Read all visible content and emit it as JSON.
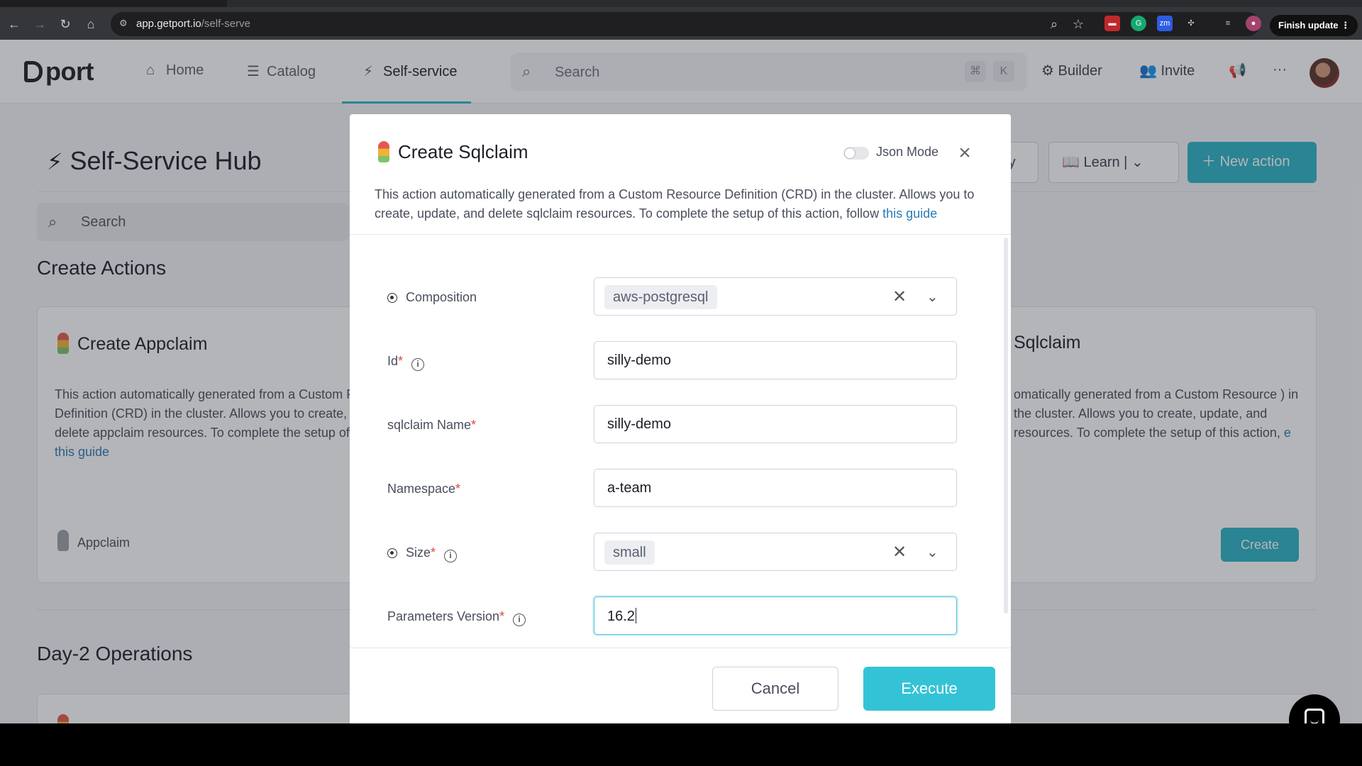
{
  "browser": {
    "url_host": "app.getport.io",
    "url_path": "/self-serve",
    "finish_update": "Finish update"
  },
  "topnav": {
    "logo": "port",
    "home": "Home",
    "catalog": "Catalog",
    "self_service": "Self-service",
    "search_placeholder": "Search",
    "kbd_cmd": "⌘",
    "kbd_k": "K",
    "builder": "Builder",
    "invite": "Invite"
  },
  "hub": {
    "title": "Self-Service Hub",
    "search_placeholder": "Search",
    "history_label": "ry",
    "learn_label": "Learn",
    "new_action": "New action",
    "create_actions_title": "Create Actions",
    "day2_title": "Day-2 Operations"
  },
  "cards": {
    "appclaim": {
      "title": "Create Appclaim",
      "desc_prefix": "This action automatically generated from a Custom Resource Definition (CRD) in the cluster. Allows you to create, update, and delete appclaim resources. To complete the setup of this action, follow ",
      "link": "this guide",
      "footer": "Appclaim"
    },
    "sqlclaim": {
      "title_partial": "Sqlclaim",
      "desc_partial": "omatically generated from a Custom Resource ) in the cluster. Allows you to create, update, and resources. To complete the setup of this action,",
      "link_partial": "e",
      "create": "Create"
    }
  },
  "modal": {
    "title": "Create Sqlclaim",
    "json_mode": "Json Mode",
    "close": "×",
    "desc_prefix": "This action automatically generated from a Custom Resource Definition (CRD) in the cluster. Allows you to create, update, and delete sqlclaim resources. To complete the setup of this action, follow ",
    "desc_link": "this guide",
    "fields": {
      "composition": {
        "label": "Composition",
        "value": "aws-postgresql"
      },
      "id": {
        "label": "Id",
        "required": "*",
        "value": "silly-demo"
      },
      "name": {
        "label": "sqlclaim Name",
        "required": "*",
        "value": "silly-demo"
      },
      "namespace": {
        "label": "Namespace",
        "required": "*",
        "value": "a-team"
      },
      "size": {
        "label": "Size",
        "required": "*",
        "value": "small"
      },
      "params_version": {
        "label": "Parameters Version",
        "required": "*",
        "value": "16.2"
      }
    },
    "cancel": "Cancel",
    "execute": "Execute"
  },
  "colors": {
    "accent": "#2cb4c6",
    "required": "#e0453a",
    "link": "#2a7ab8"
  }
}
